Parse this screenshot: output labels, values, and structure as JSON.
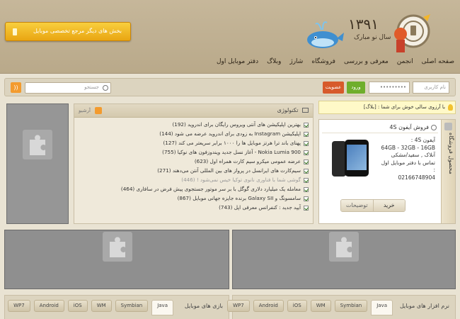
{
  "header": {
    "banner_text": "بخش های دیگر مرجع تخصصی موبایل",
    "year": "۱۳۹۱",
    "year_sub": "سال نو مبارک",
    "nav": [
      "صفحه اصلی",
      "انجمن",
      "معرفی و بررسی",
      "فروشگاه",
      "شارژ",
      "وبلاگ",
      "دفتر موبایل اول"
    ]
  },
  "toolbar": {
    "username_placeholder": "نام کاربری",
    "password_value": "•••••••••",
    "login_label": "ورود",
    "register_label": "عضویت",
    "search_placeholder": "جستجو"
  },
  "welcome": {
    "text": "با آرزوی سالی خوش برای شما : [بلاگ]"
  },
  "techbox": {
    "title": "تکنولوژی",
    "archive_label": "آرشیو",
    "items": [
      {
        "text": "بهترین اپلیکیشن های آنتی ویروس رایگان برای اندروید (192)",
        "dim": false
      },
      {
        "text": "اپلیکیشن Instagram به زودی برای اندروید عرضه می شود (144)",
        "dim": false
      },
      {
        "text": "پهنای باند ترا هرتز موبایل ها را ۱۰۰۰ برابر سریعتر می کند (127)",
        "dim": false
      },
      {
        "text": "Nokia Lumia 900 - آغاز نسل جدید ویندوزفون های نوکیا (755)",
        "dim": false
      },
      {
        "text": "عرضه عمومی میکرو سیم کارت همراه اول (623)",
        "dim": false
      },
      {
        "text": "سیم‌کارت های ایرانسل در پرواز های بین المللی آنتن می‌دهند (271)",
        "dim": false
      },
      {
        "text": "گوشی شما با فناوری نانوی توکیا خیس نمی‌شود ! (446)",
        "dim": true
      },
      {
        "text": "معامله یک میلیارد دلاری گوگل با بر سر موتور جستجوی پیش فرض در سافاری (464)",
        "dim": false
      },
      {
        "text": "سامسونگ و Galaxy SII برنده جایزه جهانی موبایل (867)",
        "dim": false
      },
      {
        "text": "آیپد جدید : کنفرانس معرفی اپل (743)",
        "dim": false
      }
    ]
  },
  "product": {
    "side_title": "محصول فروشگاه",
    "title": "فروش آیفون 4S",
    "lines": [
      "آیفون 4S :",
      "64GB - 32GB - 16GB",
      "آنلاک , سفید/مشکی",
      "تماس با دفتر موبایل اول :",
      "02166748904"
    ],
    "buy_label": "خرید",
    "desc_label": "توضیحات"
  },
  "bottom": {
    "right_title": "نرم افزار های موبایل",
    "left_title": "بازی های موبایل",
    "tabs": [
      "Java",
      "Symbian",
      "WM",
      "iOS",
      "Android",
      "WP7"
    ]
  }
}
